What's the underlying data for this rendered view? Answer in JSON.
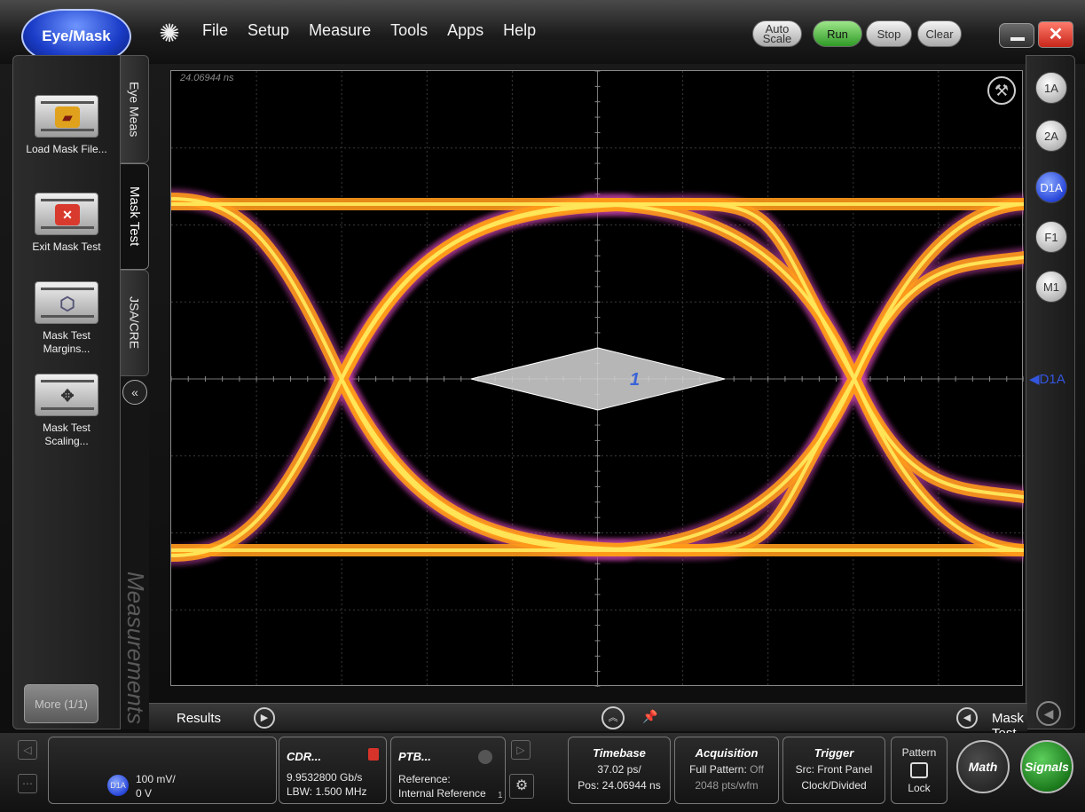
{
  "mode": "Eye/Mask",
  "menu": [
    "File",
    "Setup",
    "Measure",
    "Tools",
    "Apps",
    "Help"
  ],
  "controls": {
    "auto_scale": "Auto Scale",
    "run": "Run",
    "stop": "Stop",
    "clear": "Clear"
  },
  "window": {
    "close": "✕"
  },
  "left_panel": {
    "buttons": [
      {
        "label": "Load Mask File...",
        "icon": "folder-open-icon"
      },
      {
        "label": "Exit Mask Test",
        "icon": "exit-icon"
      },
      {
        "label": "Mask Test Margins...",
        "icon": "hexagon-icon"
      },
      {
        "label": "Mask Test Scaling...",
        "icon": "move-arrows-icon"
      }
    ],
    "more": "More (1/1)"
  },
  "tabs": [
    "Eye Meas",
    "Mask Test",
    "JSA/CRE"
  ],
  "measurements_label": "Measurements",
  "graticule": {
    "time_label": "24.06944 ns",
    "mask_number": "1"
  },
  "channels": [
    "1A",
    "2A",
    "D1A",
    "F1",
    "M1"
  ],
  "marker": "◀D1A",
  "results_bar": {
    "results": "Results",
    "mask": "Mask Test"
  },
  "status": {
    "channel_badge": "D1A",
    "scale": "100 mV/",
    "offset": "0 V",
    "cdr": {
      "title": "CDR...",
      "rate": "9.9532800 Gb/s",
      "lbw": "LBW: 1.500 MHz"
    },
    "ptb": {
      "title": "PTB...",
      "line1": "Reference:",
      "line2": "Internal Reference",
      "sub": "1"
    },
    "timebase": {
      "title": "Timebase",
      "scale": "37.02 ps/",
      "pos": "Pos: 24.06944 ns"
    },
    "acquisition": {
      "title": "Acquisition",
      "line1_label": "Full Pattern:",
      "line1_value": "Off",
      "line2": "2048 pts/wfm"
    },
    "trigger": {
      "title": "Trigger",
      "line1": "Src: Front Panel",
      "line2": "Clock/Divided"
    },
    "pattern": {
      "title": "Pattern",
      "lock": "Lock"
    },
    "math": "Math",
    "signals": "Signals"
  },
  "colors": {
    "accent_blue": "#2746d8",
    "run_green": "#2f9a26",
    "close_red": "#c7261a",
    "eye_orange": "#ff9a1a",
    "eye_yellow": "#ffe75a",
    "eye_magenta": "#c23fa8"
  }
}
